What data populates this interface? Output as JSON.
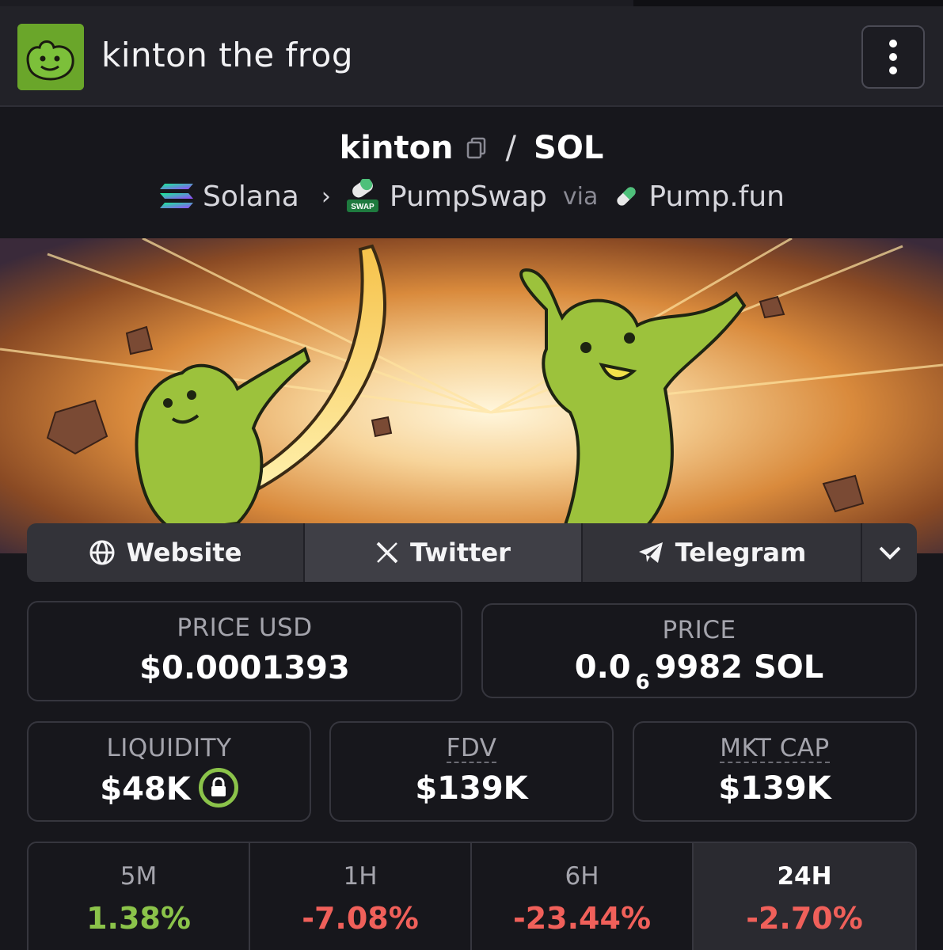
{
  "header": {
    "title": "kinton the frog",
    "logo_icon": "frog-avatar",
    "menu_icon": "kebab-menu-icon"
  },
  "pair": {
    "base": "kinton",
    "quote": "SOL",
    "separator": "/",
    "copy_icon": "copy-icon"
  },
  "route": {
    "chain": "Solana",
    "dex": "PumpSwap",
    "dex_badge": "SWAP",
    "via_label": "via",
    "launchpad": "Pump.fun"
  },
  "banner": {
    "description_icon": "banner-image"
  },
  "links": {
    "website": "Website",
    "twitter": "Twitter",
    "telegram": "Telegram",
    "more_icon": "chevron-down-icon"
  },
  "stats": {
    "price_usd_label": "PRICE USD",
    "price_usd": "$0.0001393",
    "price_label": "PRICE",
    "price_sol_prefix": "0.0",
    "price_sol_zeros": "6",
    "price_sol_rest": "9982 SOL",
    "liquidity_label": "LIQUIDITY",
    "liquidity": "$48K",
    "fdv_label": "FDV",
    "fdv": "$139K",
    "mktcap_label": "MKT CAP",
    "mktcap": "$139K"
  },
  "timeframes": [
    {
      "label": "5M",
      "value": "1.38%",
      "color": "#8bc34a"
    },
    {
      "label": "1H",
      "value": "-7.08%",
      "color": "#f0605a"
    },
    {
      "label": "6H",
      "value": "-23.44%",
      "color": "#f0605a"
    },
    {
      "label": "24H",
      "value": "-2.70%",
      "color": "#f0605a"
    }
  ],
  "colors": {
    "background": "#17171c",
    "positive": "#8bc34a",
    "negative": "#f0605a"
  }
}
